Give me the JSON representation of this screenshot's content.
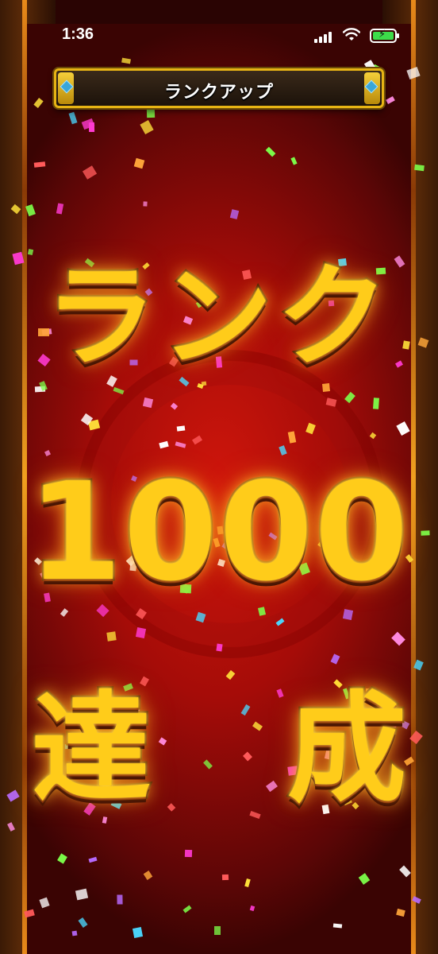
{
  "status_bar": {
    "time": "1:36",
    "icons": [
      "signal-icon",
      "wifi-icon",
      "battery-charging-icon"
    ]
  },
  "header": {
    "title": "ランクアップ"
  },
  "announcement": {
    "rank_label": "ランク",
    "rank_number": "1000",
    "achieved_char_1": "達",
    "achieved_char_2": "成"
  },
  "colors": {
    "background_red": "#b50d08",
    "gold_text": "#ffcc1a",
    "banner_border": "#e7b414",
    "battery_green": "#3ddc4a"
  }
}
